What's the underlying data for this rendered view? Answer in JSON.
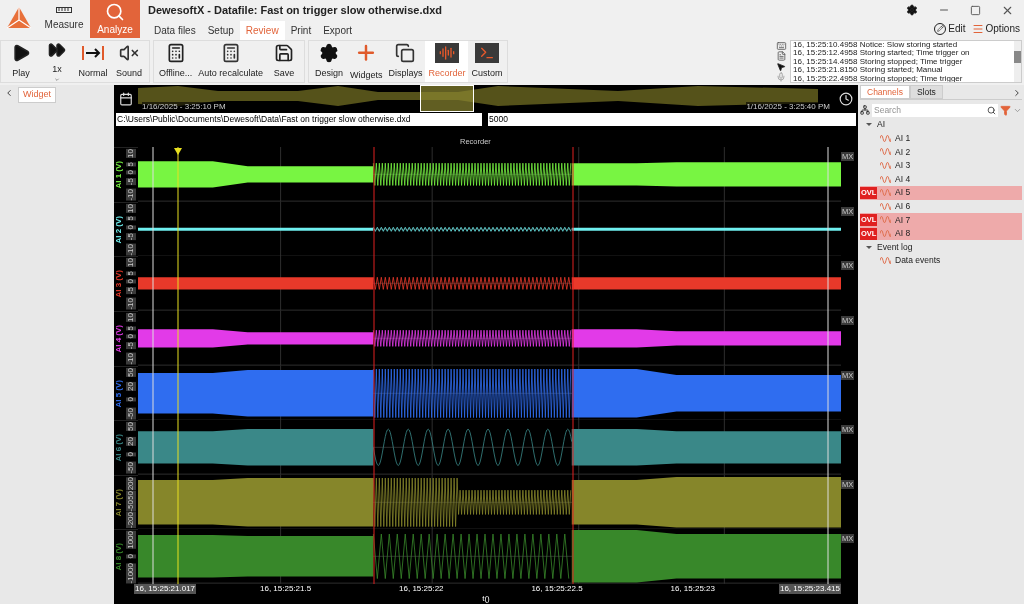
{
  "window": {
    "title": "DewesoftX - Datafile: Fast on trigger slow otherwise.dxd"
  },
  "modes": [
    {
      "label": "Measure",
      "kind": "measure",
      "selected": false
    },
    {
      "label": "Analyze",
      "kind": "analyze",
      "selected": true
    }
  ],
  "tabs": [
    {
      "label": "Data files",
      "selected": false
    },
    {
      "label": "Setup",
      "selected": false
    },
    {
      "label": "Review",
      "selected": true
    },
    {
      "label": "Print",
      "selected": false
    },
    {
      "label": "Export",
      "selected": false
    }
  ],
  "window_actions": [
    {
      "label": "Edit",
      "kind": "edit"
    },
    {
      "label": "Options",
      "kind": "options"
    }
  ],
  "toolbar_groups": [
    [
      {
        "label": "Play",
        "kind": "play",
        "dropdown": false,
        "selected": false
      },
      {
        "label": "1x",
        "kind": "speed",
        "dropdown": true,
        "selected": false
      },
      {
        "label": "Normal",
        "kind": "normal",
        "dropdown": false,
        "selected": false
      },
      {
        "label": "Sound",
        "kind": "sound",
        "dropdown": false,
        "selected": false
      }
    ],
    [
      {
        "label": "Offline...",
        "kind": "offline",
        "dropdown": false,
        "selected": false
      },
      {
        "label": "Auto recalculate",
        "kind": "recalc",
        "dropdown": false,
        "selected": false
      },
      {
        "label": "Save",
        "kind": "save",
        "dropdown": false,
        "selected": false
      }
    ],
    [
      {
        "label": "Design",
        "kind": "design",
        "dropdown": false,
        "selected": false
      },
      {
        "label": "Widgets",
        "kind": "widgets",
        "dropdown": false,
        "selected": false
      },
      {
        "label": "Displays",
        "kind": "displays",
        "dropdown": false,
        "selected": false
      },
      {
        "label": "Recorder",
        "kind": "recorder",
        "dropdown": false,
        "selected": true
      },
      {
        "label": "Custom",
        "kind": "custom",
        "dropdown": false,
        "selected": false
      }
    ]
  ],
  "event_log": [
    "16, 15:25:10.4958 Notice: Slow storing started",
    "16, 15:25:12.4958 Storing started; Time trigger on",
    "16, 15:25:14.4958 Storing stopped; Time trigger",
    "16, 15:25:21.8150 Storing started; Manual",
    "16, 15:25:22.4958 Storing stopped; Time trigger"
  ],
  "left_panel": {
    "tab": "Widget"
  },
  "overview": {
    "start": "1/16/2025 - 3:25:10 PM",
    "end": "1/16/2025 - 3:25:40 PM"
  },
  "file_path": "C:\\Users\\Public\\Documents\\Dewesoft\\Data\\Fast on trigger slow otherwise.dxd",
  "sample_field": "5000",
  "recorder": {
    "title": "Recorder",
    "channels": [
      {
        "label": "AI 1 (V)",
        "color": "#78f542",
        "ticks": [
          "10",
          "5",
          "0",
          "-5",
          "-10"
        ],
        "scale": "MX"
      },
      {
        "label": "AI 2 (V)",
        "color": "#6ff0f0",
        "ticks": [
          "10",
          "5",
          "0",
          "-5",
          "-10"
        ],
        "scale": "MX"
      },
      {
        "label": "AI 3 (V)",
        "color": "#e8392a",
        "ticks": [
          "10",
          "5",
          "0",
          "-5",
          "-10"
        ],
        "scale": "MX"
      },
      {
        "label": "AI 4 (V)",
        "color": "#e23ae8",
        "ticks": [
          "10",
          "5",
          "0",
          "-5",
          "-10"
        ],
        "scale": "MX"
      },
      {
        "label": "AI 5 (V)",
        "color": "#2f6df0",
        "ticks": [
          "50",
          "20",
          "0",
          "-50"
        ],
        "scale": "MX"
      },
      {
        "label": "AI 6 (V)",
        "color": "#3a8888",
        "ticks": [
          "50",
          "20",
          "0",
          "-50"
        ],
        "scale": "MX"
      },
      {
        "label": "AI 7 (V)",
        "color": "#86862a",
        "ticks": [
          "200",
          "50",
          "-50",
          "-200"
        ],
        "scale": "MX"
      },
      {
        "label": "AI 8 (V)",
        "color": "#38882a",
        "ticks": [
          "1000",
          "0",
          "-1000"
        ],
        "scale": "MX"
      }
    ],
    "x_start": "16, 15:25:21.017",
    "x_ticks": [
      "16, 15:25:21.5",
      "16, 15:25:22",
      "16, 15:25:22.5",
      "16, 15:25:23"
    ],
    "x_end": "16, 15:25:23.415",
    "x_label": "t()"
  },
  "channels_panel": {
    "tabs": [
      {
        "label": "Channels",
        "selected": true
      },
      {
        "label": "Slots",
        "selected": false
      }
    ],
    "search": {
      "placeholder": "Search"
    },
    "tree": [
      {
        "label": "AI",
        "expanded": true,
        "children": [
          {
            "label": "AI 1",
            "overload": false
          },
          {
            "label": "AI 2",
            "overload": false
          },
          {
            "label": "AI 3",
            "overload": false
          },
          {
            "label": "AI 4",
            "overload": false
          },
          {
            "label": "AI 5",
            "overload": true,
            "badge": "OVL"
          },
          {
            "label": "AI 6",
            "overload": false
          },
          {
            "label": "AI 7",
            "overload": true,
            "badge": "OVL"
          },
          {
            "label": "AI 8",
            "overload": true,
            "badge": "OVL"
          }
        ]
      },
      {
        "label": "Event log",
        "expanded": true,
        "children": [
          {
            "label": "Data events",
            "overload": false
          }
        ]
      }
    ]
  }
}
